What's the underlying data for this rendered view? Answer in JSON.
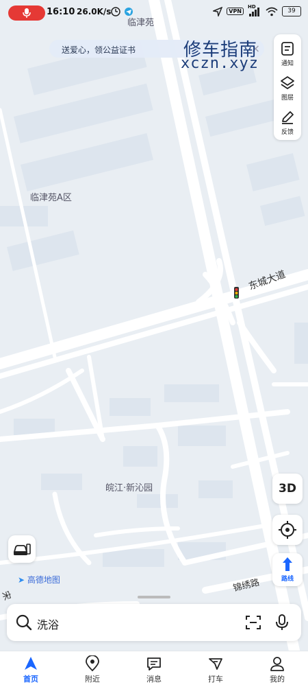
{
  "status_bar": {
    "time": "16:10",
    "network_speed": "26.0K/s",
    "vpn": "VPN",
    "hd": "HD",
    "battery": "39"
  },
  "banner": {
    "text": "送爱心，领公益证书",
    "close": "×"
  },
  "watermark": {
    "cn": "修车指南",
    "en": "xczn.xyz"
  },
  "toolbar": {
    "notify": "通知",
    "layers": "图层",
    "feedback": "反馈"
  },
  "map_labels": {
    "top": "临津苑",
    "area_a": "临津苑A区",
    "road": "东城大道",
    "community": "皖江·新沁园",
    "road_bottom": "锦绣路",
    "road_left": "宋",
    "brand": "高德地图"
  },
  "controls": {
    "btn_3d": "3D",
    "route": "路线"
  },
  "search": {
    "value": "洗浴"
  },
  "bottom_nav": [
    {
      "label": "首页",
      "icon": "home-arrow-icon",
      "active": true
    },
    {
      "label": "附近",
      "icon": "pin-icon",
      "active": false
    },
    {
      "label": "消息",
      "icon": "message-icon",
      "active": false
    },
    {
      "label": "打车",
      "icon": "taxi-icon",
      "active": false
    },
    {
      "label": "我的",
      "icon": "person-icon",
      "active": false
    }
  ],
  "colors": {
    "accent": "#1a66ff",
    "record": "#e53935",
    "map_bg": "#e9eef3",
    "road": "#ffffff"
  }
}
